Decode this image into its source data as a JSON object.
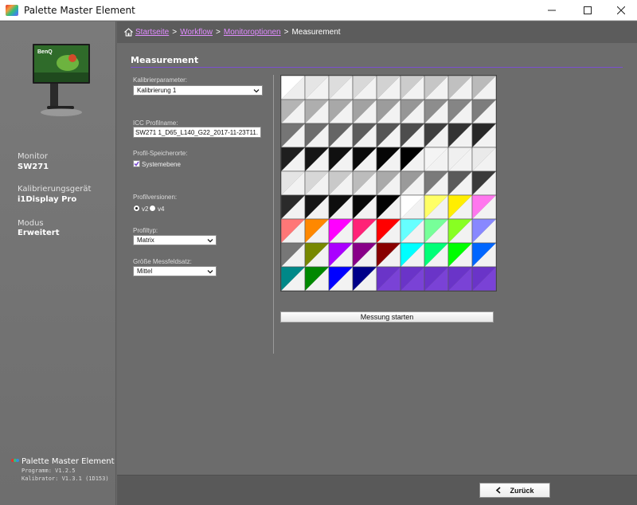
{
  "window": {
    "title": "Palette Master Element",
    "controls": [
      "minimize-icon",
      "maximize-icon",
      "close-icon"
    ]
  },
  "breadcrumb": {
    "items": [
      {
        "label": "Startseite",
        "link": true
      },
      {
        "label": "Workflow",
        "link": true
      },
      {
        "label": "Monitoroptionen",
        "link": true
      },
      {
        "label": "Measurement",
        "link": false
      }
    ],
    "separator": ">"
  },
  "sidebar": {
    "monitor_label": "Monitor",
    "monitor_value": "SW271",
    "device_label": "Kalibrierungsgerät",
    "device_value": "i1Display Pro",
    "mode_label": "Modus",
    "mode_value": "Erweitert",
    "brand": "Palette Master Element",
    "program_version": "Programm: V1.2.5",
    "calibrator_version": "Kalibrator: V1.3.1 (1D153)"
  },
  "main": {
    "title": "Measurement",
    "calibration_param_label": "Kalibrierparameter:",
    "calibration_param_value": "Kalibrierung 1",
    "icc_label": "ICC Profilname:",
    "icc_value": "SW271 1_D65_L140_G22_2017-11-23T11.",
    "storage_label": "Profil-Speicherorte:",
    "storage_option": "Systemebene",
    "storage_checked": true,
    "profile_version_label": "Profilversionen:",
    "version_options": [
      "v2",
      "v4"
    ],
    "version_selected": "v2",
    "profile_type_label": "Profiltyp:",
    "profile_type_value": "Matrix",
    "patch_size_label": "Größe Messfeldsatz:",
    "patch_size_value": "Mittel",
    "start_button": "Messung starten",
    "accent_color": "#7b4fd1"
  },
  "patches": {
    "columns": 9,
    "rows": 9,
    "cells": [
      [
        "#ffffff",
        "#eeeeee"
      ],
      [
        "#e5e5e5",
        "#f2f2f2"
      ],
      [
        "#dddddd",
        "#f2f2f2"
      ],
      [
        "#d8d8d8",
        "#f2f2f2"
      ],
      [
        "#d2d2d2",
        "#f2f2f2"
      ],
      [
        "#cccccc",
        "#f2f2f2"
      ],
      [
        "#c6c6c6",
        "#f2f2f2"
      ],
      [
        "#c0c0c0",
        "#f2f2f2"
      ],
      [
        "#bababa",
        "#f2f2f2"
      ],
      [
        "#b4b4b4",
        "#f2f2f2"
      ],
      [
        "#aeaeae",
        "#f2f2f2"
      ],
      [
        "#a8a8a8",
        "#f2f2f2"
      ],
      [
        "#a2a2a2",
        "#f2f2f2"
      ],
      [
        "#9c9c9c",
        "#f2f2f2"
      ],
      [
        "#969696",
        "#f2f2f2"
      ],
      [
        "#8d8d8d",
        "#f2f2f2"
      ],
      [
        "#858585",
        "#f2f2f2"
      ],
      [
        "#7d7d7d",
        "#f2f2f2"
      ],
      [
        "#757575",
        "#f2f2f2"
      ],
      [
        "#6d6d6d",
        "#f2f2f2"
      ],
      [
        "#656565",
        "#f2f2f2"
      ],
      [
        "#5d5d5d",
        "#f2f2f2"
      ],
      [
        "#555555",
        "#f2f2f2"
      ],
      [
        "#4d4d4d",
        "#f2f2f2"
      ],
      [
        "#3f3f3f",
        "#f2f2f2"
      ],
      [
        "#333333",
        "#f2f2f2"
      ],
      [
        "#282828",
        "#f2f2f2"
      ],
      [
        "#1e1e1e",
        "#f2f2f2"
      ],
      [
        "#161616",
        "#f2f2f2"
      ],
      [
        "#101010",
        "#f2f2f2"
      ],
      [
        "#0b0b0b",
        "#f2f2f2"
      ],
      [
        "#060606",
        "#f2f2f2"
      ],
      [
        "#000000",
        "#f2f2f2"
      ],
      [
        "#f4f4f4",
        "#f2f2f2"
      ],
      [
        "#f0f0f0",
        "#f2f2f2"
      ],
      [
        "#eaeaea",
        "#f2f2f2"
      ],
      [
        "#e4e4e4",
        "#f2f2f2"
      ],
      [
        "#d7d7d7",
        "#f2f2f2"
      ],
      [
        "#c9c9c9",
        "#f2f2f2"
      ],
      [
        "#bcbcbc",
        "#f2f2f2"
      ],
      [
        "#aaaaaa",
        "#f2f2f2"
      ],
      [
        "#9a9a9a",
        "#f2f2f2"
      ],
      [
        "#7a7a7a",
        "#f2f2f2"
      ],
      [
        "#5a5a5a",
        "#f2f2f2"
      ],
      [
        "#3a3a3a",
        "#f2f2f2"
      ],
      [
        "#2a2a2a",
        "#f2f2f2"
      ],
      [
        "#151515",
        "#f2f2f2"
      ],
      [
        "#0e0e0e",
        "#f2f2f2"
      ],
      [
        "#080808",
        "#f2f2f2"
      ],
      [
        "#030303",
        "#f2f2f2"
      ],
      [
        "#ffffff",
        "#f2f2f2"
      ],
      [
        "#ffff66",
        "#f2f2f2"
      ],
      [
        "#ffee00",
        "#f2f2f2"
      ],
      [
        "#ff77ee",
        "#f2f2f2"
      ],
      [
        "#ff7777",
        "#f2f2f2"
      ],
      [
        "#ff8800",
        "#f2f2f2"
      ],
      [
        "#ff00ff",
        "#f2f2f2"
      ],
      [
        "#ff2277",
        "#f2f2f2"
      ],
      [
        "#ff0000",
        "#f2f2f2"
      ],
      [
        "#66ffff",
        "#f2f2f2"
      ],
      [
        "#77ff99",
        "#f2f2f2"
      ],
      [
        "#88ff22",
        "#f2f2f2"
      ],
      [
        "#8888ff",
        "#f2f2f2"
      ],
      [
        "#777777",
        "#f2f2f2"
      ],
      [
        "#778800",
        "#f2f2f2"
      ],
      [
        "#aa00ff",
        "#f2f2f2"
      ],
      [
        "#880088",
        "#f2f2f2"
      ],
      [
        "#880000",
        "#f2f2f2"
      ],
      [
        "#00ffff",
        "#f2f2f2"
      ],
      [
        "#00ff77",
        "#f2f2f2"
      ],
      [
        "#00ff00",
        "#f2f2f2"
      ],
      [
        "#0066ff",
        "#f2f2f2"
      ],
      [
        "#008888",
        "#f2f2f2"
      ],
      [
        "#008800",
        "#f2f2f2"
      ],
      [
        "#0000ff",
        "#f2f2f2"
      ],
      [
        "#000088",
        "#f2f2f2"
      ],
      [
        "#6a34c8",
        "#7a42d6"
      ],
      [
        "#6a34c8",
        "#7a42d6"
      ],
      [
        "#6a34c8",
        "#7a42d6"
      ],
      [
        "#6a34c8",
        "#7a42d6"
      ],
      [
        "#6a34c8",
        "#7a42d6"
      ]
    ]
  },
  "footer": {
    "back_button": "Zurück"
  }
}
